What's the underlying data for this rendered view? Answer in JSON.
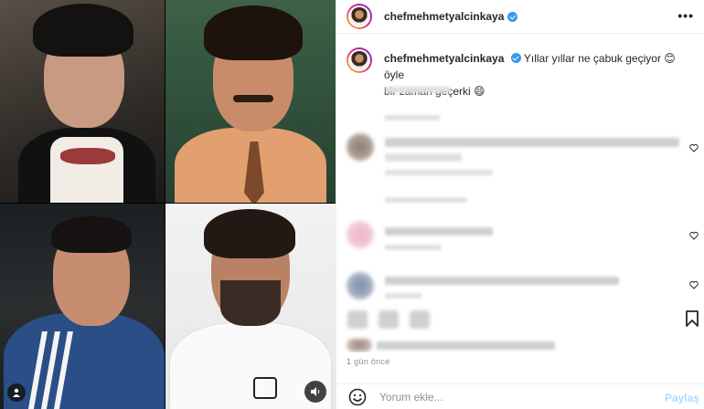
{
  "header": {
    "username": "chefmehmetyalcinkaya",
    "verified_icon": "verified-badge-icon",
    "more_icon": "more-options-icon"
  },
  "caption": {
    "username": "chefmehmetyalcinkaya",
    "text_line1": "Yıllar yıllar ne çabuk geçiyor 😊 öyle",
    "text_line2": "bir zaman geçerki 😄"
  },
  "media": {
    "tiles": [
      "photo-young-bowtie",
      "photo-young-tie",
      "photo-chef-jacket",
      "photo-chef-white"
    ],
    "user_tag_icon": "user-tag-icon",
    "sound_icon": "sound-icon"
  },
  "actions": {
    "bookmark_icon": "bookmark-icon",
    "like_icon": "heart-icon"
  },
  "footer": {
    "time_ago": "1 gün önce"
  },
  "comment_bar": {
    "placeholder": "Yorum ekle...",
    "post_label": "Paylaş",
    "emoji_icon": "emoji-icon"
  },
  "colors": {
    "verified": "#3897f0",
    "post_button": "#b3dbff",
    "muted_text": "#8e8e8e"
  }
}
